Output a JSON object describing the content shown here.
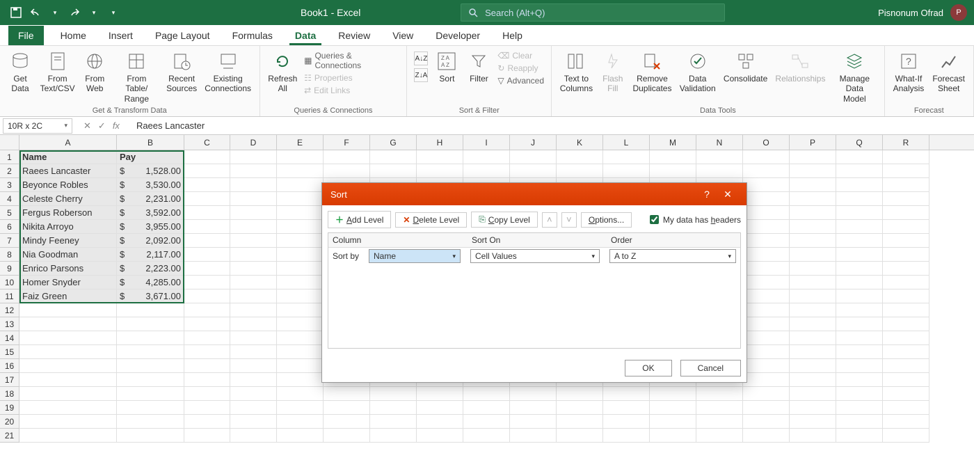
{
  "title": "Book1  -  Excel",
  "search_placeholder": "Search (Alt+Q)",
  "user": "Pisnonum Ofrad",
  "tabs": [
    "File",
    "Home",
    "Insert",
    "Page Layout",
    "Formulas",
    "Data",
    "Review",
    "View",
    "Developer",
    "Help"
  ],
  "active_tab": "Data",
  "ribbon": {
    "get_transform": {
      "label": "Get & Transform Data",
      "get_data": "Get\nData",
      "from_textcsv": "From\nText/CSV",
      "from_web": "From\nWeb",
      "from_table": "From Table/\nRange",
      "recent_sources": "Recent\nSources",
      "existing_conn": "Existing\nConnections"
    },
    "queries": {
      "label": "Queries & Connections",
      "refresh_all": "Refresh\nAll",
      "qc": "Queries & Connections",
      "properties": "Properties",
      "edit_links": "Edit Links"
    },
    "sortfilter": {
      "label": "Sort & Filter",
      "sort": "Sort",
      "filter": "Filter",
      "clear": "Clear",
      "reapply": "Reapply",
      "advanced": "Advanced"
    },
    "datatools": {
      "label": "Data Tools",
      "text_cols": "Text to\nColumns",
      "flash_fill": "Flash\nFill",
      "remove_dup": "Remove\nDuplicates",
      "validation": "Data\nValidation",
      "consolidate": "Consolidate",
      "relationships": "Relationships",
      "manage_dm": "Manage\nData Model"
    },
    "forecast": {
      "label": "Forecast",
      "what_if": "What-If\nAnalysis",
      "forecast_sheet": "Forecast\nSheet"
    }
  },
  "namebox": "10R x 2C",
  "formula": "Raees Lancaster",
  "columns": [
    "A",
    "B",
    "C",
    "D",
    "E",
    "F",
    "G",
    "H",
    "I",
    "J",
    "K",
    "L",
    "M",
    "N",
    "O",
    "P",
    "Q",
    "R"
  ],
  "headers": {
    "A": "Name",
    "B": "Pay"
  },
  "rows": [
    {
      "name": "Raees Lancaster",
      "pay": "1,528.00"
    },
    {
      "name": "Beyonce Robles",
      "pay": "3,530.00"
    },
    {
      "name": "Celeste Cherry",
      "pay": "2,231.00"
    },
    {
      "name": "Fergus Roberson",
      "pay": "3,592.00"
    },
    {
      "name": "Nikita Arroyo",
      "pay": "3,955.00"
    },
    {
      "name": "Mindy Feeney",
      "pay": "2,092.00"
    },
    {
      "name": "Nia Goodman",
      "pay": "2,117.00"
    },
    {
      "name": "Enrico Parsons",
      "pay": "2,223.00"
    },
    {
      "name": "Homer Snyder",
      "pay": "4,285.00"
    },
    {
      "name": "Faiz Green",
      "pay": "3,671.00"
    }
  ],
  "currency": "$",
  "dialog": {
    "title": "Sort",
    "add_level": "Add Level",
    "delete_level": "Delete Level",
    "copy_level": "Copy Level",
    "options": "Options...",
    "headers_chk": "My data has headers",
    "col_hdr": "Column",
    "sorton_hdr": "Sort On",
    "order_hdr": "Order",
    "sort_by": "Sort by",
    "col_val": "Name",
    "sorton_val": "Cell Values",
    "order_val": "A to Z",
    "ok": "OK",
    "cancel": "Cancel"
  }
}
